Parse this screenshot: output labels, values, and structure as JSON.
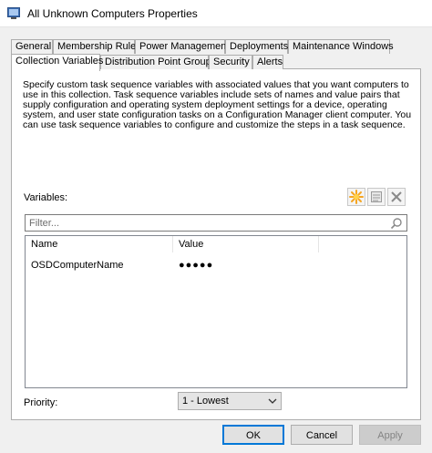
{
  "window": {
    "title": "All Unknown Computers Properties"
  },
  "tabs_row1": [
    {
      "label": "General"
    },
    {
      "label": "Membership Rules"
    },
    {
      "label": "Power Management"
    },
    {
      "label": "Deployments"
    },
    {
      "label": "Maintenance Windows"
    }
  ],
  "tabs_row2": [
    {
      "label": "Collection Variables",
      "active": true
    },
    {
      "label": "Distribution Point Groups"
    },
    {
      "label": "Security"
    },
    {
      "label": "Alerts"
    }
  ],
  "panel": {
    "description": "Specify custom task sequence variables with associated values that you want computers to use in this collection. Task sequence variables include sets of names and value pairs that supply configuration and operating system deployment settings for a device, operating system, and user state configuration tasks on a Configuration Manager client computer. You can use task sequence variables to configure and customize the steps in a task sequence.",
    "variables_label": "Variables:",
    "toolbar": {
      "new_icon": "new-star-icon",
      "edit_icon": "properties-icon",
      "delete_icon": "delete-x-icon"
    },
    "filter": {
      "placeholder": "Filter...",
      "value": ""
    },
    "list": {
      "columns": [
        "Name",
        "Value"
      ],
      "rows": [
        {
          "name": "OSDComputerName",
          "value": "●●●●●"
        }
      ]
    },
    "priority": {
      "label": "Priority:",
      "selected": "1 - Lowest"
    }
  },
  "buttons": {
    "ok": "OK",
    "cancel": "Cancel",
    "apply": "Apply"
  },
  "colors": {
    "accent": "#0078d7",
    "star": "#f5a623"
  }
}
